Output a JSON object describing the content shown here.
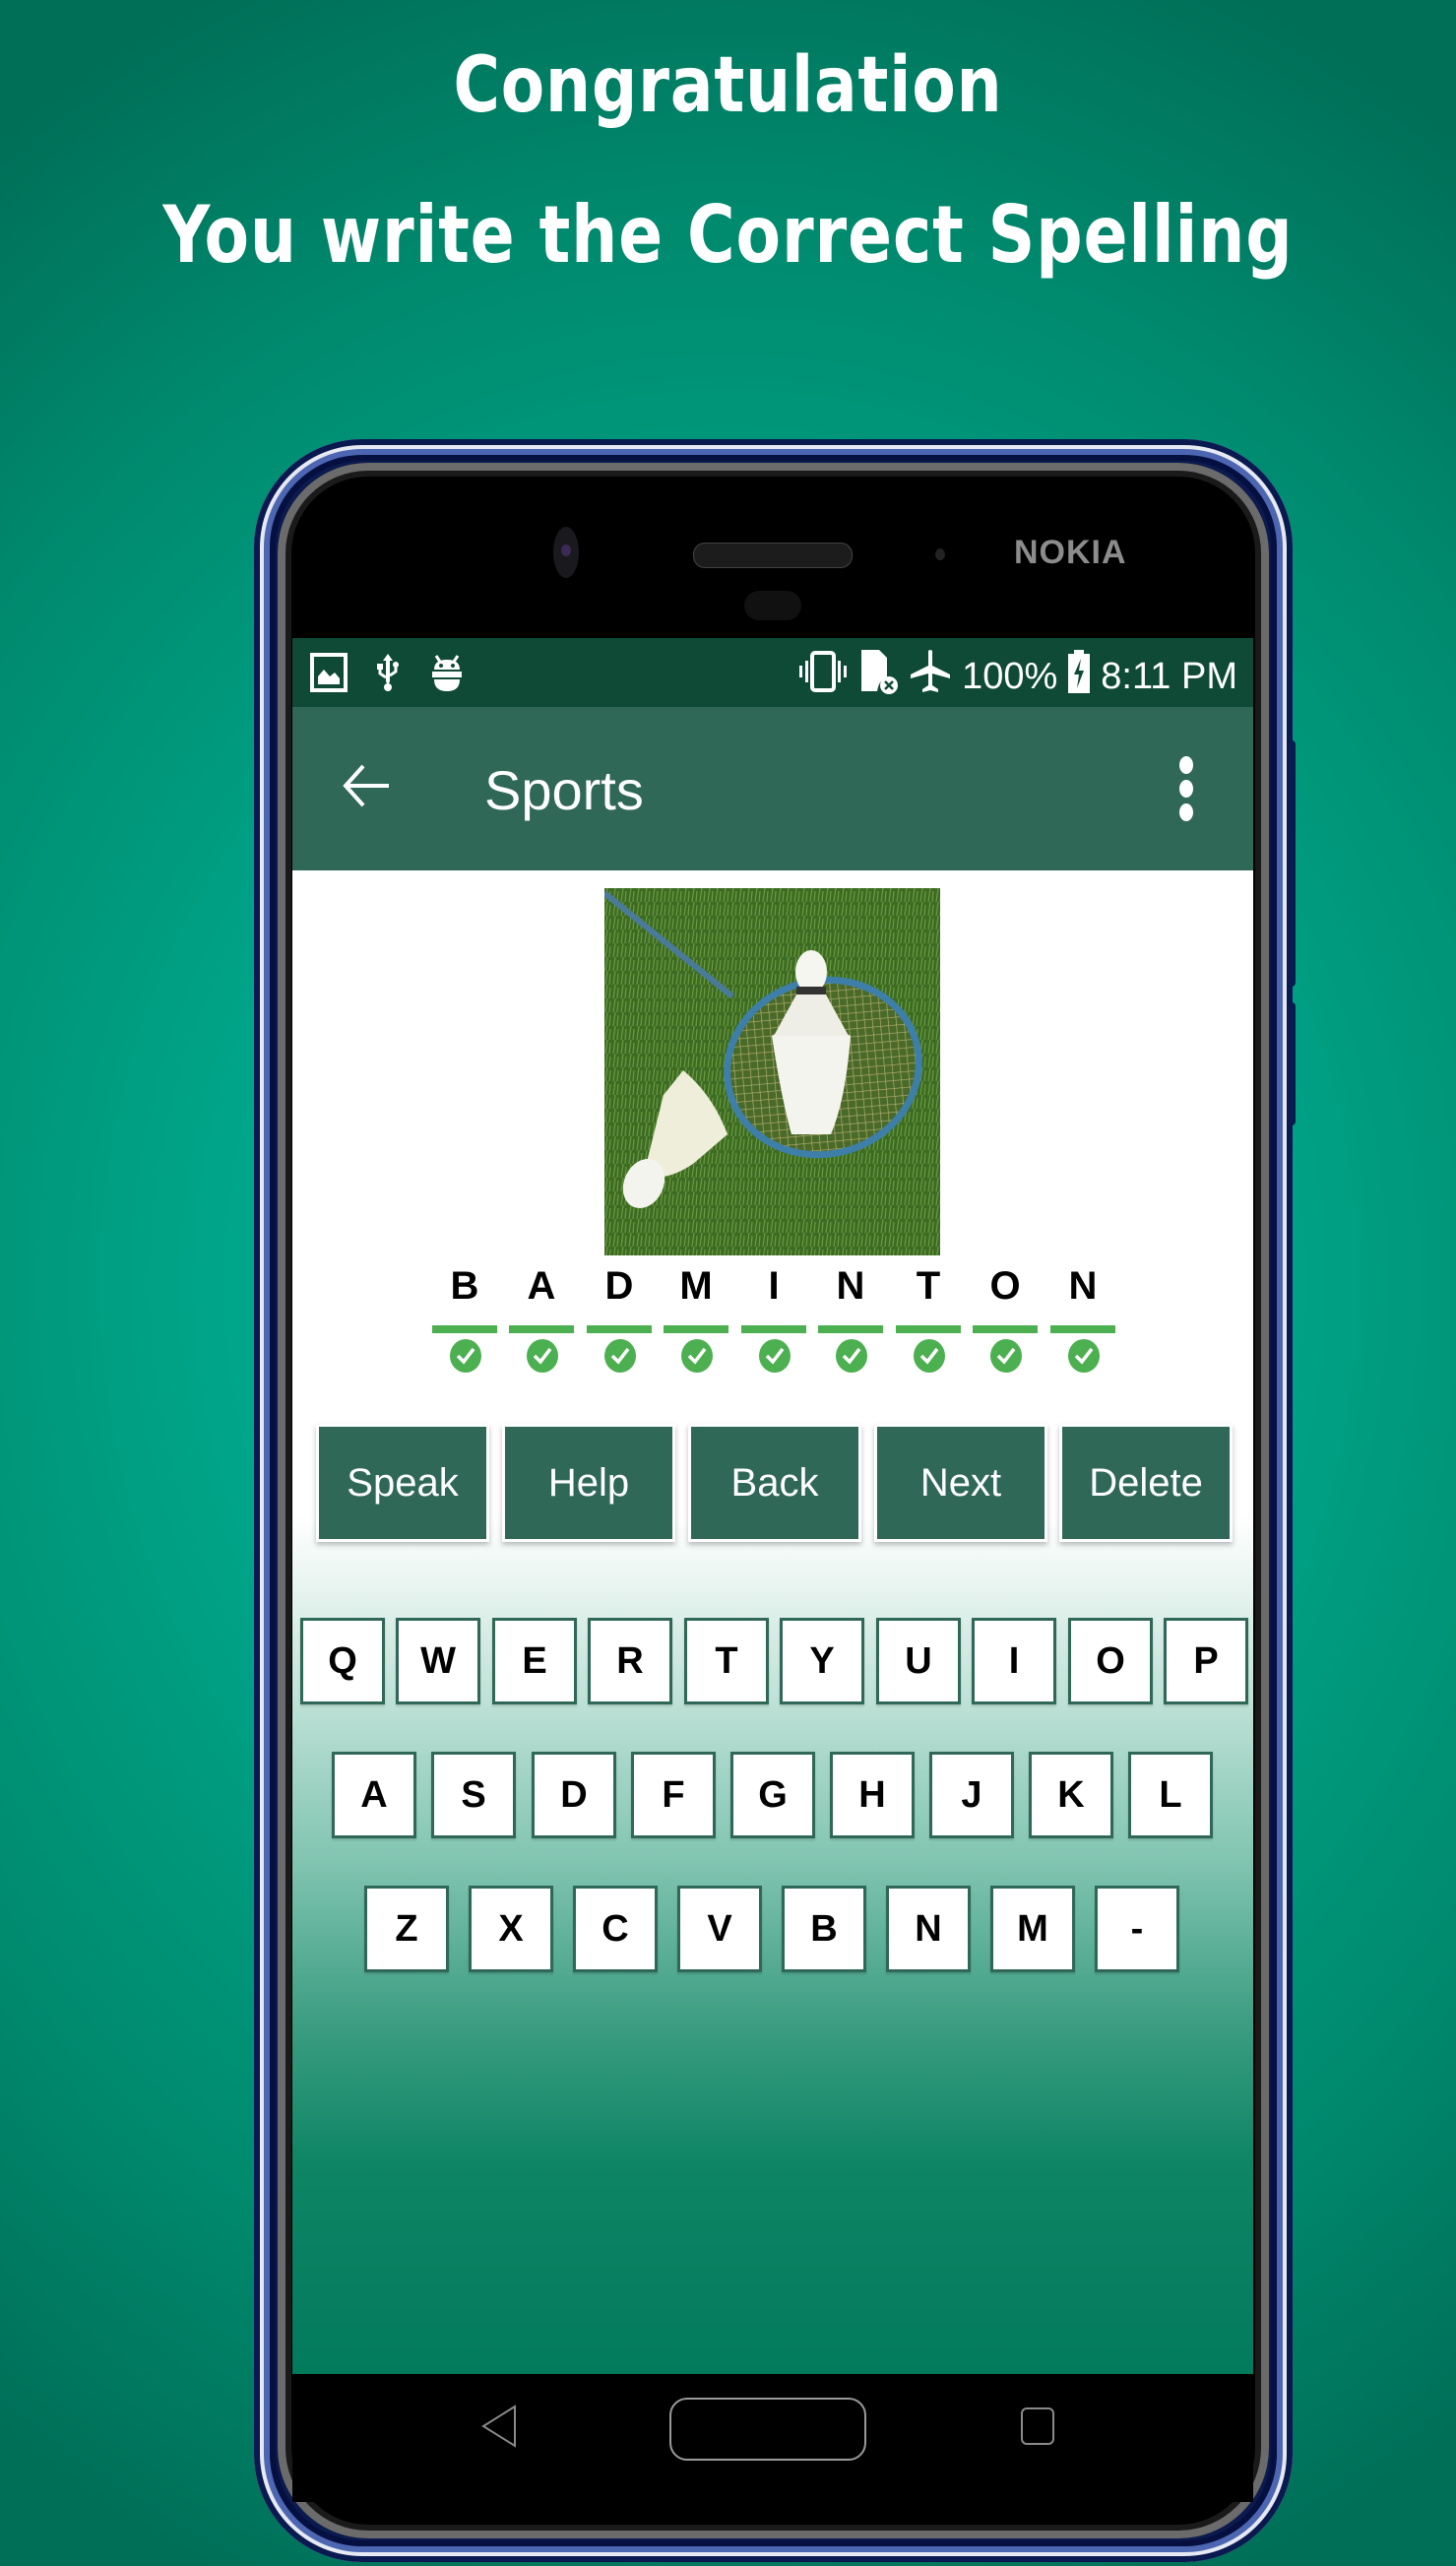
{
  "promo": {
    "headline": "Congratulation",
    "subheadline": "You write the Correct Spelling"
  },
  "device": {
    "brand": "NOKIA"
  },
  "status_bar": {
    "left_icons": [
      "image-icon",
      "usb-icon",
      "android-debug-icon"
    ],
    "right_icons": [
      "vibrate-icon",
      "sim-missing-icon",
      "airplane-mode-icon"
    ],
    "battery_percent": "100%",
    "battery_icon": "battery-charging-icon",
    "time": "8:11 PM"
  },
  "app_bar": {
    "back_icon": "arrow-back-icon",
    "title": "Sports",
    "menu_icon": "more-vertical-icon"
  },
  "puzzle": {
    "image_alt": "Badminton racket and shuttlecocks on grass",
    "answer": "BADMINTON",
    "letters": [
      {
        "char": "B",
        "status": "correct"
      },
      {
        "char": "A",
        "status": "correct"
      },
      {
        "char": "D",
        "status": "correct"
      },
      {
        "char": "M",
        "status": "correct"
      },
      {
        "char": "I",
        "status": "correct"
      },
      {
        "char": "N",
        "status": "correct"
      },
      {
        "char": "T",
        "status": "correct"
      },
      {
        "char": "O",
        "status": "correct"
      },
      {
        "char": "N",
        "status": "correct"
      }
    ],
    "correct_color": "#4caf50"
  },
  "actions": [
    {
      "label": "Speak"
    },
    {
      "label": "Help"
    },
    {
      "label": "Back"
    },
    {
      "label": "Next"
    },
    {
      "label": "Delete"
    }
  ],
  "keyboard": {
    "rows": [
      [
        "Q",
        "W",
        "E",
        "R",
        "T",
        "Y",
        "U",
        "I",
        "O",
        "P"
      ],
      [
        "A",
        "S",
        "D",
        "F",
        "G",
        "H",
        "J",
        "K",
        "L"
      ],
      [
        "Z",
        "X",
        "C",
        "V",
        "B",
        "N",
        "M",
        "-"
      ]
    ]
  },
  "nav_bar": {
    "back": "nav-back-icon",
    "home": "nav-home-button",
    "recents": "nav-recents-icon"
  },
  "colors": {
    "primary": "#306858",
    "status_bar": "#0f4a37",
    "accent_correct": "#4caf50",
    "background_teal": "#00a68a"
  }
}
